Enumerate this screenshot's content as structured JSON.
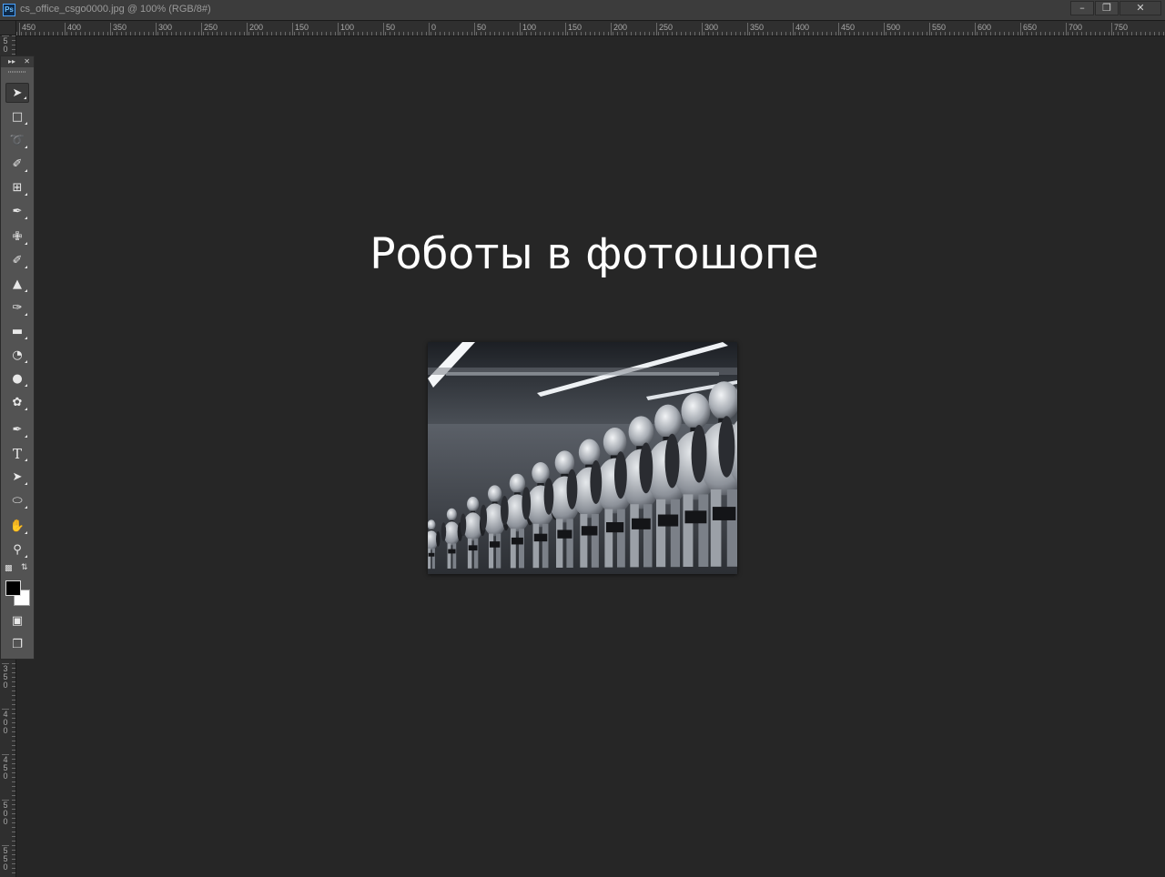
{
  "window": {
    "app_icon": "Ps",
    "document_title": "cs_office_csgo0000.jpg @ 100% (RGB/8#)",
    "controls": {
      "minimize": "minimize-icon",
      "restore": "restore-icon",
      "close": "close-icon"
    }
  },
  "ruler_top": {
    "labels": [
      "450",
      "400",
      "350",
      "300",
      "250",
      "200",
      "150",
      "100",
      "50",
      "0",
      "50",
      "100",
      "150",
      "200",
      "250",
      "300",
      "350",
      "400",
      "450",
      "500",
      "550",
      "600",
      "650",
      "700",
      "750"
    ]
  },
  "ruler_left": {
    "labels": [
      "5\n0",
      "3\n5\n0",
      "4\n0\n0",
      "4\n5\n0",
      "5\n0\n0",
      "5\n5\n0"
    ]
  },
  "toolbar": {
    "tools": [
      {
        "icon": "move-tool-icon"
      },
      {
        "icon": "rectangular-marquee-tool-icon"
      },
      {
        "icon": "lasso-tool-icon"
      },
      {
        "icon": "quick-selection-tool-icon"
      },
      {
        "icon": "crop-tool-icon"
      },
      {
        "icon": "eyedropper-tool-icon"
      },
      {
        "icon": "spot-healing-brush-tool-icon"
      },
      {
        "icon": "brush-tool-icon"
      },
      {
        "icon": "clone-stamp-tool-icon"
      },
      {
        "icon": "history-brush-tool-icon"
      },
      {
        "icon": "eraser-tool-icon"
      },
      {
        "icon": "paint-bucket-tool-icon"
      },
      {
        "icon": "blur-tool-icon"
      },
      {
        "icon": "dodge-tool-icon"
      },
      {
        "icon": "pen-tool-icon"
      },
      {
        "icon": "type-tool-icon",
        "glyph": "T"
      },
      {
        "icon": "path-selection-tool-icon"
      },
      {
        "icon": "ellipse-tool-icon"
      },
      {
        "icon": "hand-tool-icon"
      },
      {
        "icon": "zoom-tool-icon"
      }
    ],
    "foreground_color": "#000000",
    "background_color": "#ffffff"
  },
  "document": {
    "heading": "Роботы в фотошопе",
    "image": "robots-photo"
  },
  "colors": {
    "app_background": "#262626",
    "panel": "#535353",
    "title_bar": "#3c3c3c",
    "heading_text": "#ffffff"
  }
}
